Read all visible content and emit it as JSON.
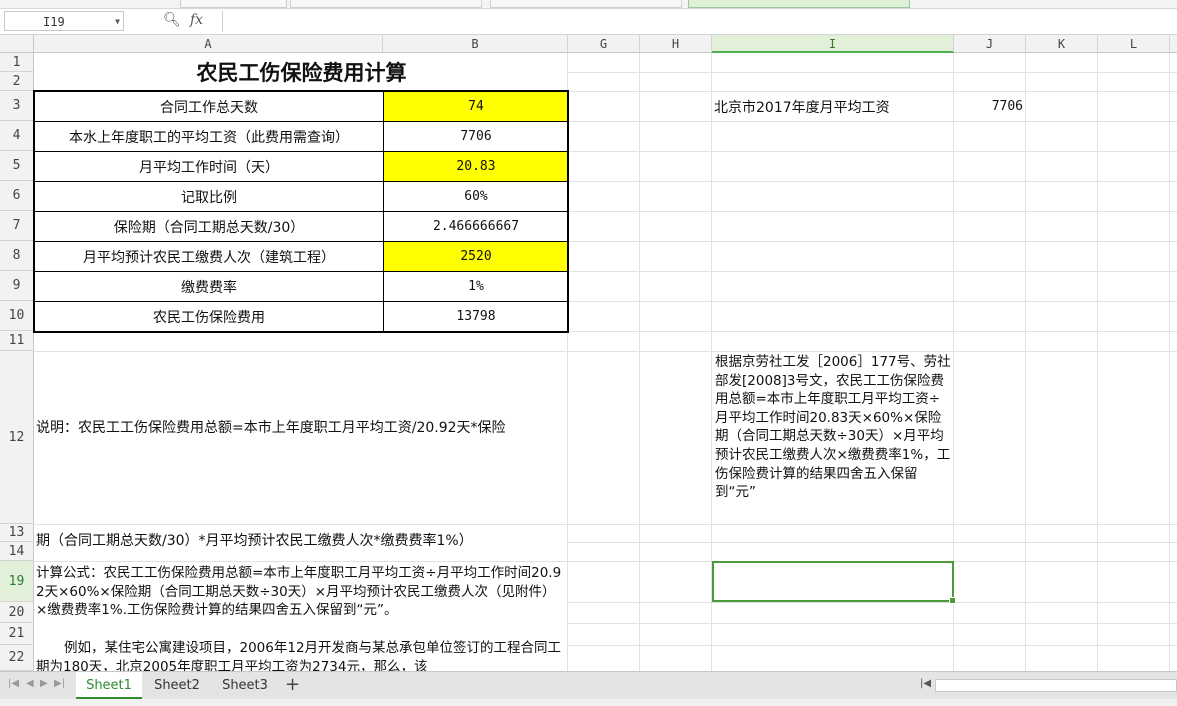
{
  "formula_bar": {
    "cell_ref": "I19",
    "fx_label": "fx",
    "formula": ""
  },
  "columns": [
    {
      "key": "A",
      "label": "A"
    },
    {
      "key": "B",
      "label": "B"
    },
    {
      "key": "G",
      "label": "G"
    },
    {
      "key": "H",
      "label": "H"
    },
    {
      "key": "I",
      "label": "I"
    },
    {
      "key": "J",
      "label": "J"
    },
    {
      "key": "K",
      "label": "K"
    },
    {
      "key": "L",
      "label": "L"
    }
  ],
  "rows": [
    "1",
    "2",
    "3",
    "4",
    "5",
    "6",
    "7",
    "8",
    "9",
    "10",
    "11",
    "12",
    "13",
    "14",
    "19",
    "20",
    "21",
    "22"
  ],
  "selected_column": "I",
  "selected_row": "19",
  "title": "农民工伤保险费用计算",
  "table": [
    {
      "label": "合同工作总天数",
      "value": "74",
      "highlight": true
    },
    {
      "label": "本水上年度职工的平均工资（此费用需查询）",
      "value": "7706",
      "highlight": false
    },
    {
      "label": "月平均工作时间（天）",
      "value": "20.83",
      "highlight": true
    },
    {
      "label": "记取比例",
      "value": "60%",
      "highlight": false
    },
    {
      "label": "保险期（合同工期总天数/30）",
      "value": "2.466666667",
      "highlight": false
    },
    {
      "label": "月平均预计农民工缴费人次（建筑工程）",
      "value": "2520",
      "highlight": true
    },
    {
      "label": "缴费费率",
      "value": "1%",
      "highlight": false
    },
    {
      "label": "农民工伤保险费用",
      "value": "13798",
      "highlight": false
    }
  ],
  "side": {
    "label": "北京市2017年度月平均工资",
    "value": "7706"
  },
  "notes": {
    "row12": "说明：农民工工伤保险费用总额=本市上年度职工月平均工资/20.92天*保险",
    "row13": "期（合同工期总天数/30）*月平均预计农民工缴费人次*缴费费率1%）",
    "calc": "计算公式：农民工工伤保险费用总额=本市上年度职工月平均工资÷月平均工作时间20.92天×60%×保险期（合同工期总天数÷30天）×月平均预计农民工缴费人次（见附件）×缴费费率1%.工伤保险费计算的结果四舍五入保留到“元”。",
    "example": "例如，某住宅公寓建设项目，2006年12月开发商与某总承包单位签订的工程合同工期为180天，北京2005年度职工月平均工资为2734元，那么，该",
    "policy": "根据京劳社工发［2006］177号、劳社部发[2008]3号文，农民工工伤保险费用总额=本市上年度职工月平均工资÷月平均工作时间20.83天×60%×保险期（合同工期总天数÷30天）×月平均预计农民工缴费人次×缴费费率1%，工伤保险费计算的结果四舍五入保留到“元”"
  },
  "sheets": [
    {
      "name": "Sheet1",
      "active": true
    },
    {
      "name": "Sheet2",
      "active": false
    },
    {
      "name": "Sheet3",
      "active": false
    }
  ],
  "colors": {
    "highlight": "#ffff00",
    "selection": "#4a9a3a",
    "active_tab": "#2e8b2e"
  }
}
